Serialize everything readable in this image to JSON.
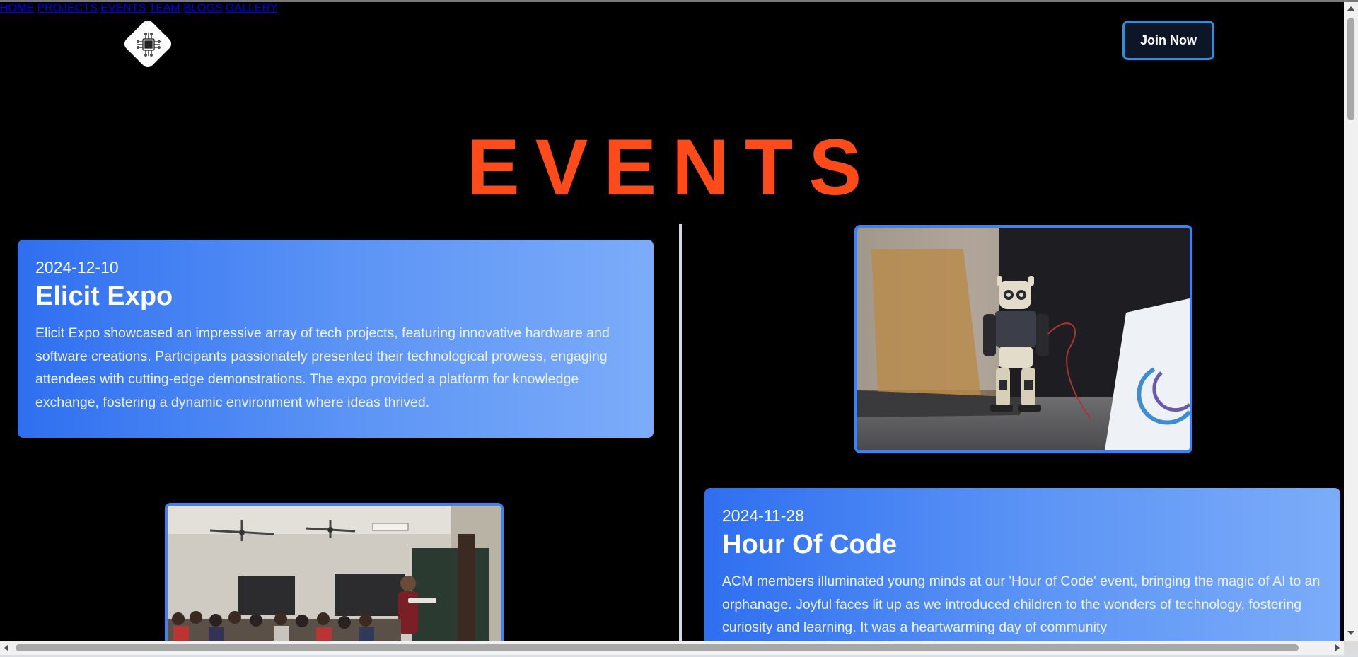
{
  "site": {
    "logo_icon": "circuit-chip-icon"
  },
  "nav": {
    "items": [
      {
        "label": "HOME"
      },
      {
        "label": "PROJECTS"
      },
      {
        "label": "EVENTS"
      },
      {
        "label": "TEAM"
      },
      {
        "label": "BLOGS"
      },
      {
        "label": "GALLERY"
      }
    ],
    "join_label": "Join Now"
  },
  "page": {
    "title": "EVENTS"
  },
  "events": [
    {
      "date": "2024-12-10",
      "name": "Elicit Expo",
      "description": "Elicit Expo showcased an impressive array of tech projects, featuring innovative hardware and software creations. Participants passionately presented their technological prowess, engaging attendees with cutting-edge demonstrations. The expo provided a platform for knowledge exchange, fostering a dynamic environment where ideas thrived."
    },
    {
      "date": "2024-11-28",
      "name": "Hour Of Code",
      "description": "ACM members illuminated young minds at our 'Hour of Code' event, bringing the magic of AI to an orphanage. Joyful faces lit up as we introduced children to the wonders of technology, fostering curiosity and learning. It was a heartwarming day of community"
    }
  ],
  "colors": {
    "accent_title": "#ff4a1a",
    "card_gradient_start": "#2f6ff0",
    "card_gradient_end": "#7cacf9",
    "photo_border": "#3b82f6",
    "join_border": "#2d8fe0",
    "background": "#000000"
  }
}
